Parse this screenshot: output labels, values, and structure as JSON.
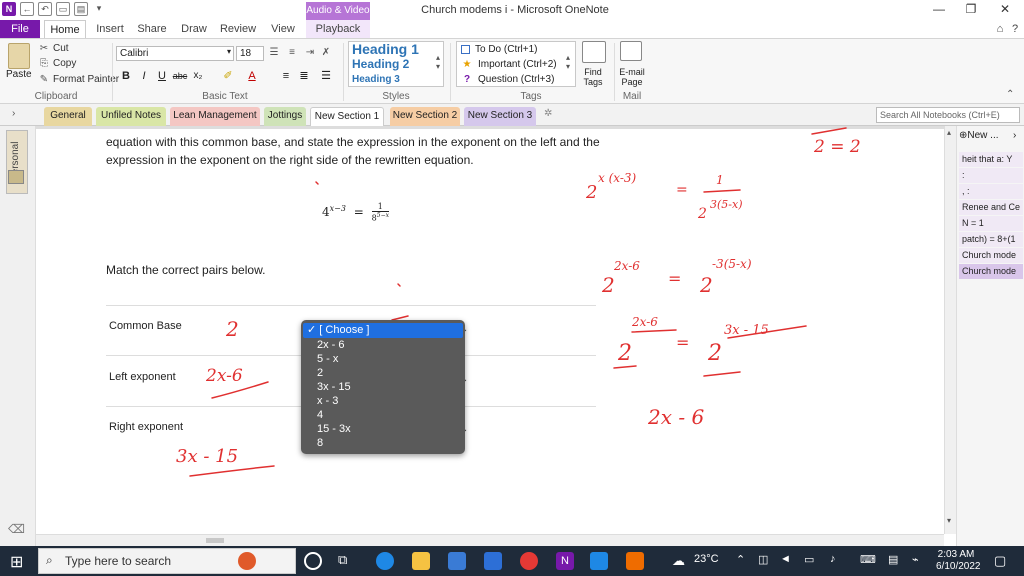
{
  "window": {
    "title": "Church modems i - Microsoft OneNote",
    "context_tab_group": "Audio & Video",
    "minimize": "—",
    "restore": "❐",
    "close": "✕"
  },
  "ribbon_tabs": [
    "File",
    "Home",
    "Insert",
    "Share",
    "Draw",
    "Review",
    "View",
    "Playback"
  ],
  "clipboard": {
    "paste": "Paste",
    "cut": "Cut",
    "copy": "Copy",
    "format_painter": "Format Painter",
    "group": "Clipboard"
  },
  "basic_text": {
    "font": "Calibri",
    "size": "18",
    "group": "Basic Text",
    "bold": "B",
    "italic": "I",
    "underline": "U",
    "strike": "abc",
    "subscript": "x₂"
  },
  "styles": {
    "h1": "Heading 1",
    "h2": "Heading 2",
    "h3": "Heading 3",
    "group": "Styles"
  },
  "tags": {
    "todo": "To Do (Ctrl+1)",
    "important": "Important (Ctrl+2)",
    "question": "Question (Ctrl+3)",
    "find_tags": "Find Tags",
    "group": "Tags"
  },
  "mail": {
    "email_page": "E-mail Page",
    "group": "Mail"
  },
  "section_tabs": [
    {
      "label": "General",
      "color": "#e8d7a0"
    },
    {
      "label": "Unfiled Notes",
      "color": "#d9e6a6"
    },
    {
      "label": "Lean Management",
      "color": "#f4c7c3"
    },
    {
      "label": "Jottings",
      "color": "#cfe3b8"
    },
    {
      "label": "New Section 1",
      "color": "#ffffff"
    },
    {
      "label": "New Section 2",
      "color": "#f6cda4"
    },
    {
      "label": "New Section 3",
      "color": "#d5c8ec"
    }
  ],
  "search_placeholder": "Search All Notebooks (Ctrl+E)",
  "notebook": {
    "name": "Personal"
  },
  "page": {
    "para1": "equation with this common base, and state the expression in the exponent on the left and the",
    "para2": "expression in the exponent on the right side of the rewritten equation.",
    "equation_lhs_base": "4",
    "equation_lhs_exp": "x−3",
    "equation_eq": "=",
    "equation_num": "1",
    "equation_den_base": "8",
    "equation_den_exp": "5−x",
    "match_prompt": "Match the correct pairs below.",
    "rows": [
      {
        "label": "Common Base"
      },
      {
        "label": "Left exponent"
      },
      {
        "label": "Right exponent"
      }
    ]
  },
  "dropdown": {
    "selected": "[ Choose ]",
    "options": [
      "2x - 6",
      "5 - x",
      "2",
      "3x - 15",
      "x - 3",
      "4",
      "15 - 3x",
      "8"
    ]
  },
  "handwriting": {
    "common_base": "2",
    "left_exp": "2x-6",
    "right_exp": "3x - 15",
    "top_right": "2 = 2",
    "line1_base": "2",
    "line1_exp": "x (x-3)",
    "line1_num": "1",
    "line1_den": "2",
    "line1_den_exp": "3(5-x)",
    "line2_base": "2",
    "line2_exp": "2x-6",
    "line2_rhs_base": "2",
    "line2_rhs_exp": "-3(5-x)",
    "line3_base": "2",
    "line3_exp": "2x-6",
    "line3_rhs_base": "2",
    "line3_rhs_exp": "3x - 15",
    "line4": "2x - 6"
  },
  "page_list": {
    "new_page": "New ...",
    "items": [
      "heit that a: Y",
      ":",
      ", :",
      "Renee and Ce",
      "N = 1",
      "patch) = 8+(1",
      "Church mode",
      "Church mode"
    ]
  },
  "taskbar": {
    "search_placeholder": "Type here to search",
    "weather": "23°C",
    "time": "2:03 AM",
    "date": "6/10/2022"
  }
}
